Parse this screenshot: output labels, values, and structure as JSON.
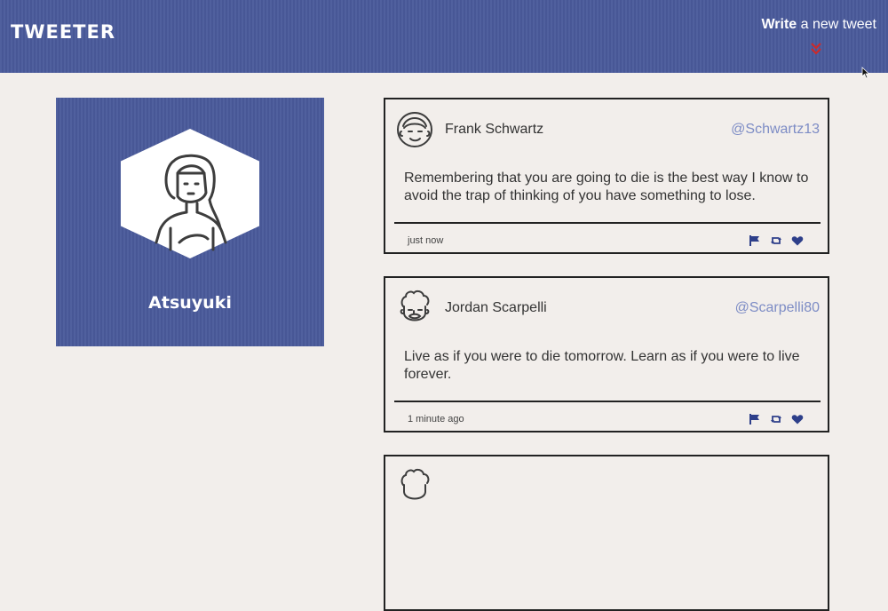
{
  "nav": {
    "brand": "TWEETER",
    "compose_bold": "Write",
    "compose_rest": " a new tweet"
  },
  "profile": {
    "name": "Atsuyuki"
  },
  "tweets": [
    {
      "author": "Frank Schwartz",
      "handle": "@Schwartz13",
      "text": "Remembering that you are going to die is the best way I know to avoid the trap of thinking of you have something to lose.",
      "time": "just now"
    },
    {
      "author": "Jordan Scarpelli",
      "handle": "@Scarpelli80",
      "text": "Live as if you were to die tomorrow. Learn as if you were to live forever.",
      "time": "1 minute ago"
    }
  ],
  "colors": {
    "primary": "#4a5a9b",
    "background": "#f2eeeb",
    "handle": "#7d8cc5",
    "arrow": "#cc2a2a"
  }
}
